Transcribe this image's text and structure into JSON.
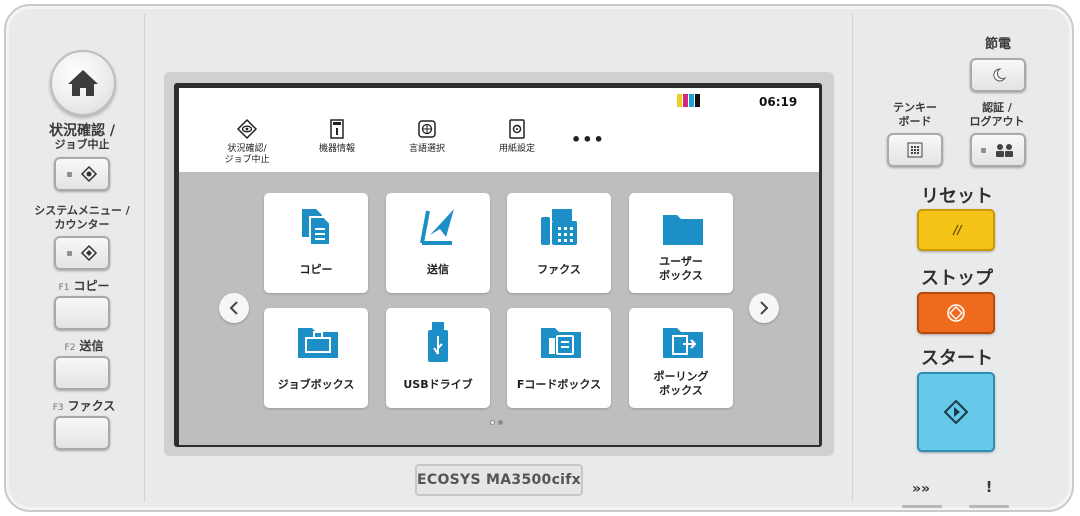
{
  "left_panel": {
    "status_label": [
      "状況確認 /",
      "ジョブ中止"
    ],
    "system_label": [
      "システムメニュー /",
      "カウンター"
    ],
    "f1": {
      "key": "F1",
      "label": "コピー"
    },
    "f2": {
      "key": "F2",
      "label": "送信"
    },
    "f3": {
      "key": "F3",
      "label": "ファクス"
    },
    "icons": {
      "home": "home-icon",
      "status": "status-diamond-icon",
      "system": "system-menu-icon"
    }
  },
  "screen": {
    "time": "06:19",
    "toner_colors": [
      "#e8d21e",
      "#d6277d",
      "#1aa3d9",
      "#111111"
    ],
    "quick_items": [
      {
        "label_lines": [
          "状況確認/",
          "ジョブ中止"
        ],
        "icon": "status-eye-icon"
      },
      {
        "label_lines": [
          "機器情報"
        ],
        "icon": "device-info-icon"
      },
      {
        "label_lines": [
          "言語選択"
        ],
        "icon": "language-icon"
      },
      {
        "label_lines": [
          "用紙設定"
        ],
        "icon": "paper-settings-icon"
      }
    ],
    "more": "•••",
    "tiles": [
      {
        "label_lines": [
          "コピー"
        ],
        "icon": "copy-icon"
      },
      {
        "label_lines": [
          "送信"
        ],
        "icon": "send-icon"
      },
      {
        "label_lines": [
          "ファクス"
        ],
        "icon": "fax-icon"
      },
      {
        "label_lines": [
          "ユーザー",
          "ボックス"
        ],
        "icon": "user-box-folder-icon"
      },
      {
        "label_lines": [
          "ジョブボックス"
        ],
        "icon": "job-box-icon"
      },
      {
        "label_lines": [
          "USBドライブ"
        ],
        "icon": "usb-icon"
      },
      {
        "label_lines": [
          "Fコードボックス"
        ],
        "icon": "fcode-box-icon"
      },
      {
        "label_lines": [
          "ポーリング",
          "ボックス"
        ],
        "icon": "polling-box-icon"
      }
    ],
    "page_indicator": {
      "pages": 2,
      "current": 1
    },
    "accent": "#1d8fc7"
  },
  "model": "ECOSYS MA3500cifx",
  "right_panel": {
    "power_saver": "節電",
    "keypad_label": [
      "テンキー",
      "ボード"
    ],
    "auth_label": [
      "認証 /",
      "ログアウト"
    ],
    "reset": "リセット",
    "stop": "ストップ",
    "start": "スタート",
    "colors": {
      "reset": "#f4c316",
      "stop": "#ee6a1d",
      "start": "#68c8ea"
    },
    "indicators": [
      "»»",
      "!"
    ]
  }
}
